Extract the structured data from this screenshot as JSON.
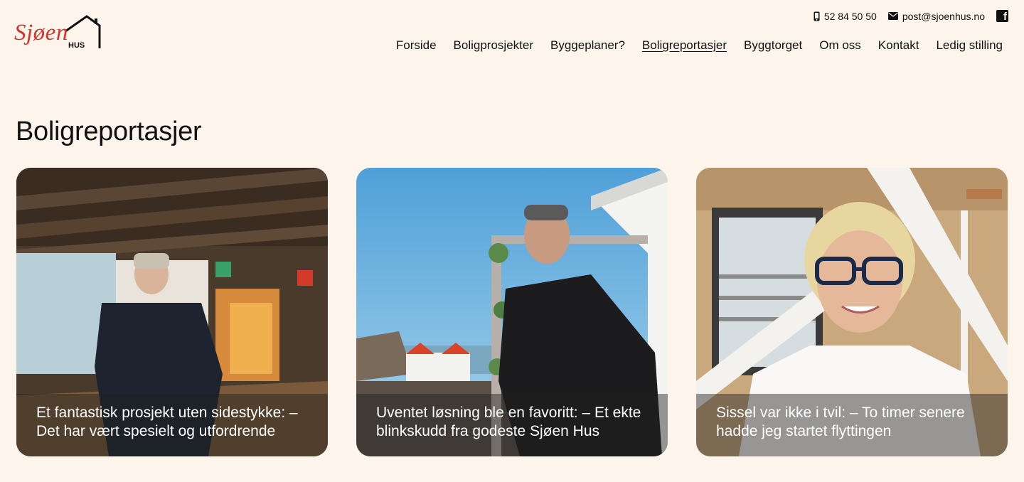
{
  "brand": {
    "logo_text": "Sjøen",
    "logo_subtext": "HUS",
    "accent_color": "#d8302a"
  },
  "contact": {
    "phone_icon": "mobile-phone-icon",
    "phone": "52 84 50 50",
    "email_icon": "envelope-icon",
    "email": "post@sjoenhus.no",
    "social_icon": "facebook-icon"
  },
  "nav": {
    "items": [
      {
        "label": "Forside"
      },
      {
        "label": "Boligprosjekter"
      },
      {
        "label": "Byggeplaner?"
      },
      {
        "label": "Boligreportasjer"
      },
      {
        "label": "Byggtorget"
      },
      {
        "label": "Om oss"
      },
      {
        "label": "Kontakt"
      },
      {
        "label": "Ledig stilling"
      }
    ],
    "active": "Boligreportasjer"
  },
  "page": {
    "title": "Boligreportasjer",
    "background": "#fdf5ec"
  },
  "cards": [
    {
      "line1": "Et fantastisk prosjekt uten sidestykke: –",
      "line2": "Det har vært spesielt og utfordrende"
    },
    {
      "line1": "Uventet løsning ble en favoritt: – Et ekte",
      "line2": "blinkskudd fra godeste Sjøen Hus"
    },
    {
      "line1": "Sissel var ikke i tvil: – To timer senere",
      "line2": "hadde jeg startet flyttingen"
    }
  ]
}
